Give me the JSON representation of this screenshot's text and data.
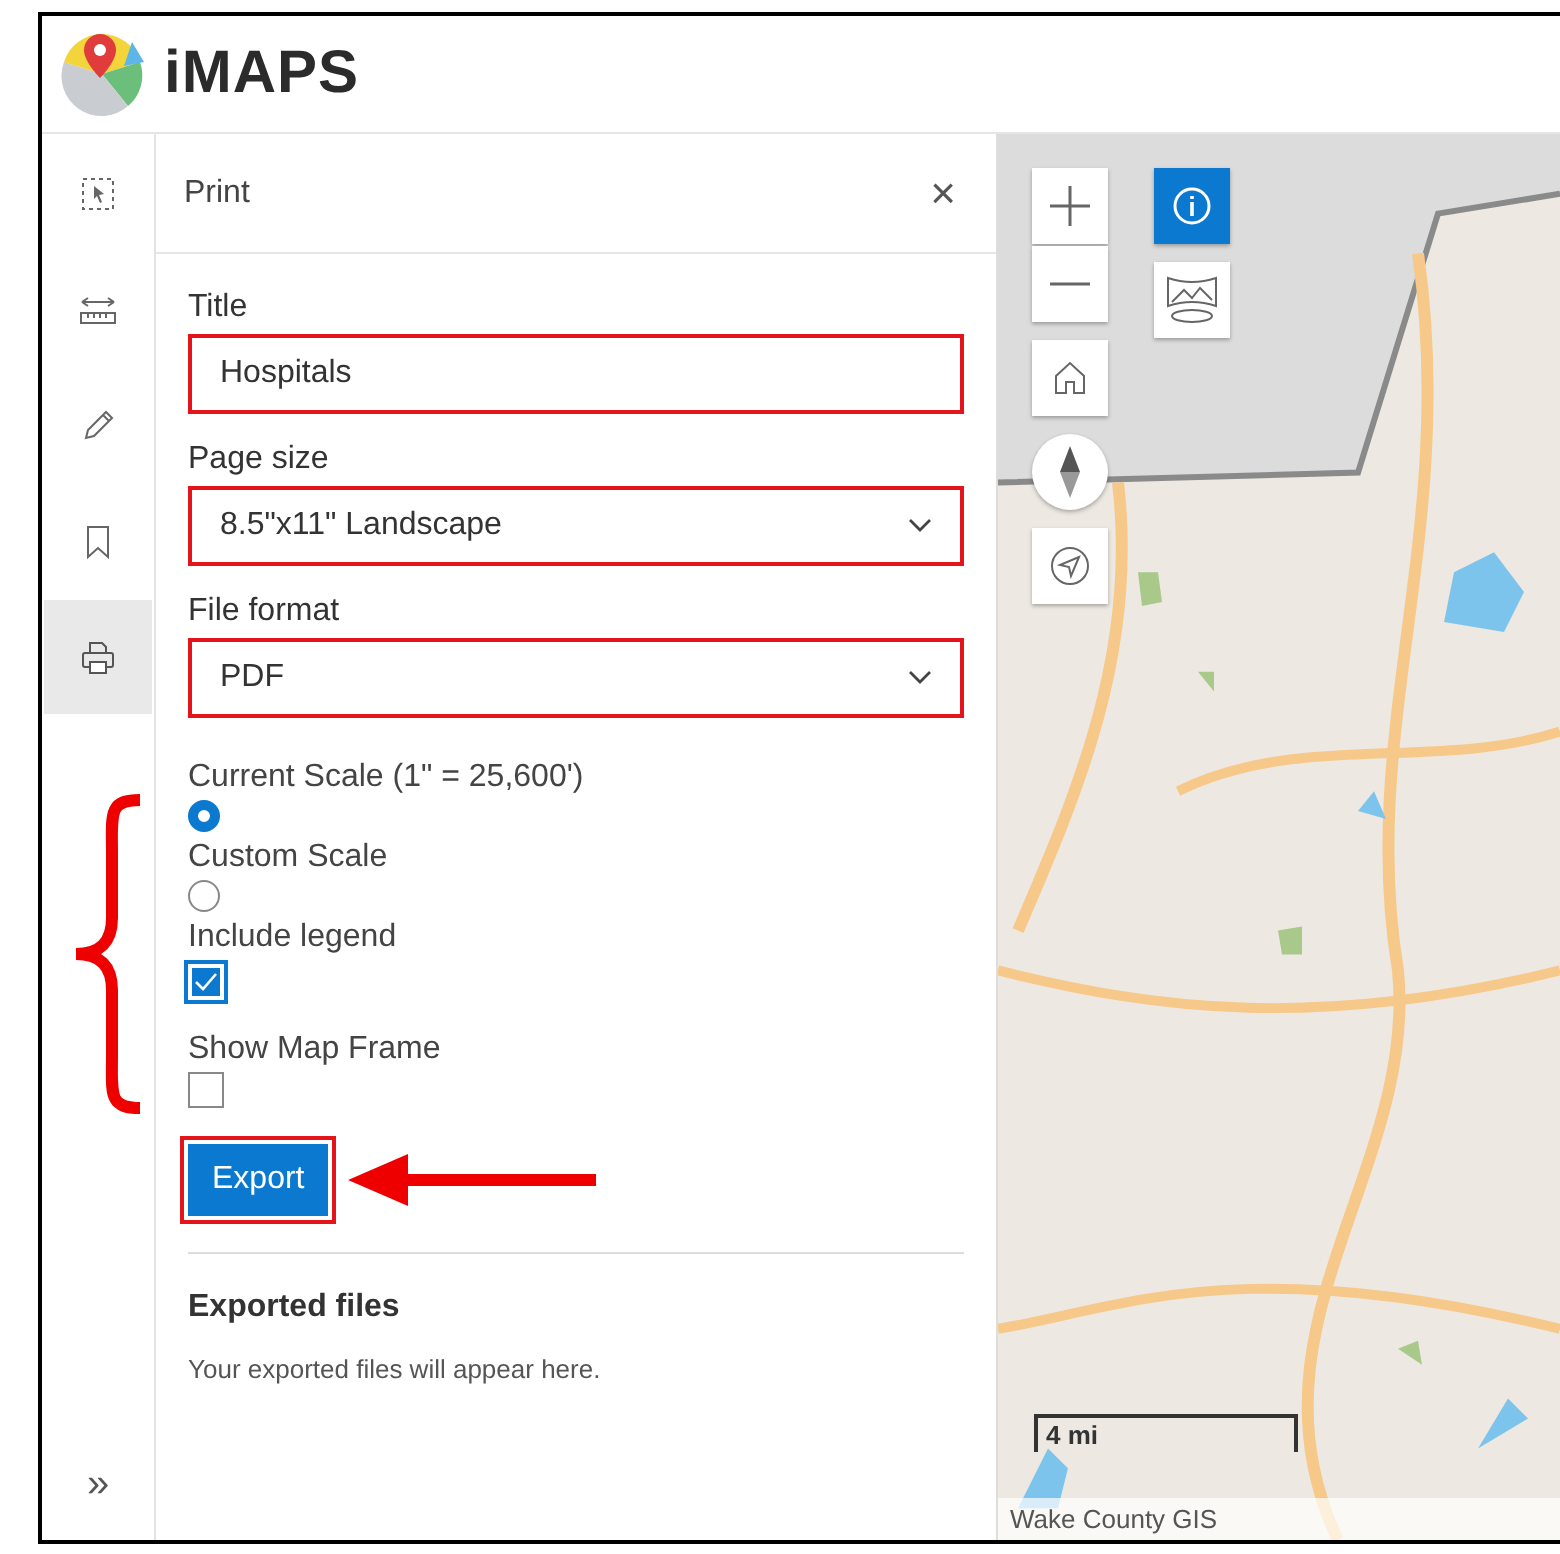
{
  "app": {
    "logo_text": "iMAPS"
  },
  "toolbar": [
    {
      "selected": false
    },
    {
      "selected": false
    },
    {
      "selected": false
    },
    {
      "selected": false
    },
    {
      "selected": true
    }
  ],
  "expand_button": {
    "label": "»"
  },
  "panel": {
    "title": "Print",
    "close": "×",
    "fields": [
      {
        "label": "Title",
        "kind": "text",
        "value": "Hospitals",
        "highlighted": true
      },
      {
        "label": "Page size",
        "kind": "select",
        "value": "8.5\"x11\" Landscape",
        "highlighted": true
      },
      {
        "label": "File format",
        "kind": "select",
        "value": "PDF",
        "highlighted": true
      }
    ],
    "scale_options": [
      {
        "label": "Current Scale (1\" = 25,600')",
        "selected": true
      },
      {
        "label": "Custom Scale",
        "selected": false
      }
    ],
    "checkboxes": [
      {
        "label": "Include legend",
        "checked": true
      },
      {
        "label": "Show Map Frame",
        "checked": false
      }
    ],
    "export_button": {
      "label": "Export",
      "highlighted": true
    },
    "exported": {
      "heading": "Exported files",
      "message": "Your exported files will appear here."
    }
  },
  "map": {
    "scale_bar": "4 mi",
    "attribution": "Wake County GIS",
    "controls": [
      {
        "selected": false
      },
      {
        "selected": false
      },
      {
        "selected": false
      },
      {
        "selected": false
      },
      {
        "selected": false
      },
      {
        "selected": true
      },
      {
        "selected": false
      }
    ]
  }
}
